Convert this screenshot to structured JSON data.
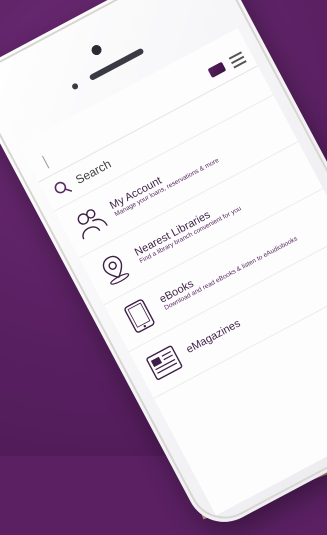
{
  "status_bar": {
    "left": "",
    "right": ""
  },
  "header": {
    "brand_primary_title": "",
    "brand_primary_sub": "",
    "brand_secondary_title": "",
    "brand_secondary_sub": ""
  },
  "search": {
    "label": "Search"
  },
  "menu_items": [
    {
      "title": "My Account",
      "description": "Manage your loans, reservations & more",
      "icon": "people-icon"
    },
    {
      "title": "Nearest Libraries",
      "description": "Find a library branch convenient for you",
      "icon": "location-pin-icon"
    },
    {
      "title": "eBooks",
      "description": "Download and read eBooks & listen to eAudiobooks",
      "icon": "tablet-icon"
    },
    {
      "title": "eMagazines",
      "description": "",
      "icon": "magazine-icon"
    }
  ],
  "colors": {
    "background": "#5a2062",
    "accent": "#5b2a63"
  }
}
